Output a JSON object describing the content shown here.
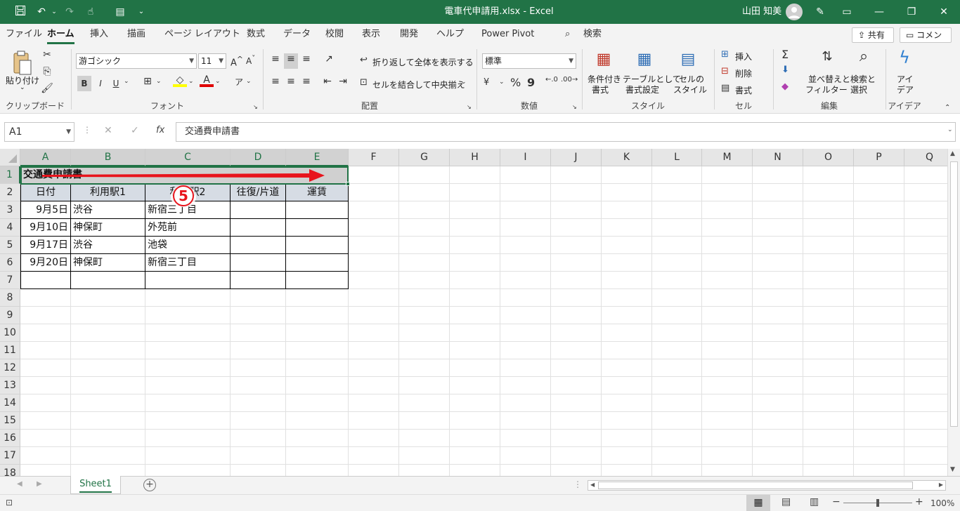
{
  "window": {
    "title": "電車代申請用.xlsx  -  Excel",
    "user_name": "山田 知美"
  },
  "ribbon_tabs": [
    "ファイル",
    "ホーム",
    "挿入",
    "描画",
    "ページ レイアウト",
    "数式",
    "データ",
    "校閲",
    "表示",
    "開発",
    "ヘルプ",
    "Power Pivot"
  ],
  "search_label": "検索",
  "share_label": "共有",
  "comment_label": "コメント",
  "ribbon": {
    "clipboard": {
      "paste": "貼り付け",
      "label": "クリップボード"
    },
    "font": {
      "name": "游ゴシック",
      "size": "11",
      "bold": "B",
      "italic": "I",
      "underline": "U",
      "label": "フォント"
    },
    "alignment": {
      "wrap": "折り返して全体を表示する",
      "merge": "セルを結合して中央揃え",
      "label": "配置"
    },
    "number": {
      "format": "標準",
      "percent": "%",
      "comma": "9",
      "label": "数値"
    },
    "styles": {
      "conditional_1": "条件付き",
      "conditional_2": "書式",
      "table_1": "テーブルとして",
      "table_2": "書式設定",
      "cell_1": "セルの",
      "cell_2": "スタイル",
      "label": "スタイル"
    },
    "cells": {
      "insert": "挿入",
      "delete": "削除",
      "format": "書式",
      "label": "セル"
    },
    "editing": {
      "sort_1": "並べ替えと",
      "sort_2": "フィルター",
      "find_1": "検索と",
      "find_2": "選択",
      "label": "編集"
    },
    "ideas": {
      "l1": "アイ",
      "l2": "デア",
      "label": "アイデア"
    }
  },
  "formula_bar": {
    "name_box": "A1",
    "cancel": "✕",
    "enter": "✓",
    "fx": "fx",
    "content": "交通費申請書"
  },
  "sheet": {
    "columns": [
      "A",
      "B",
      "C",
      "D",
      "E",
      "F",
      "G",
      "H",
      "I",
      "J",
      "K",
      "L",
      "M",
      "N",
      "O",
      "P",
      "Q"
    ],
    "rows": [
      "1",
      "2",
      "3",
      "4",
      "5",
      "6",
      "7",
      "8",
      "9",
      "10",
      "11",
      "12",
      "13",
      "14",
      "15",
      "16",
      "17",
      "18"
    ],
    "title": "交通費申請書",
    "headers": [
      "日付",
      "利用駅1",
      "利用駅2",
      "往復/片道",
      "運賃"
    ],
    "data_rows": [
      [
        "9月5日",
        "渋谷",
        "新宿三丁目",
        "",
        ""
      ],
      [
        "9月10日",
        "神保町",
        "外苑前",
        "",
        ""
      ],
      [
        "9月17日",
        "渋谷",
        "池袋",
        "",
        ""
      ],
      [
        "9月20日",
        "神保町",
        "新宿三丁目",
        "",
        ""
      ]
    ],
    "annotation_step": "5",
    "header_fill": "#d6dce4",
    "selection_color": "#217346",
    "arrow_color": "#e8141c"
  },
  "sheet_tabs": [
    "Sheet1"
  ],
  "status": {
    "zoom": "100%",
    "zoom_fraction": 0.5
  }
}
